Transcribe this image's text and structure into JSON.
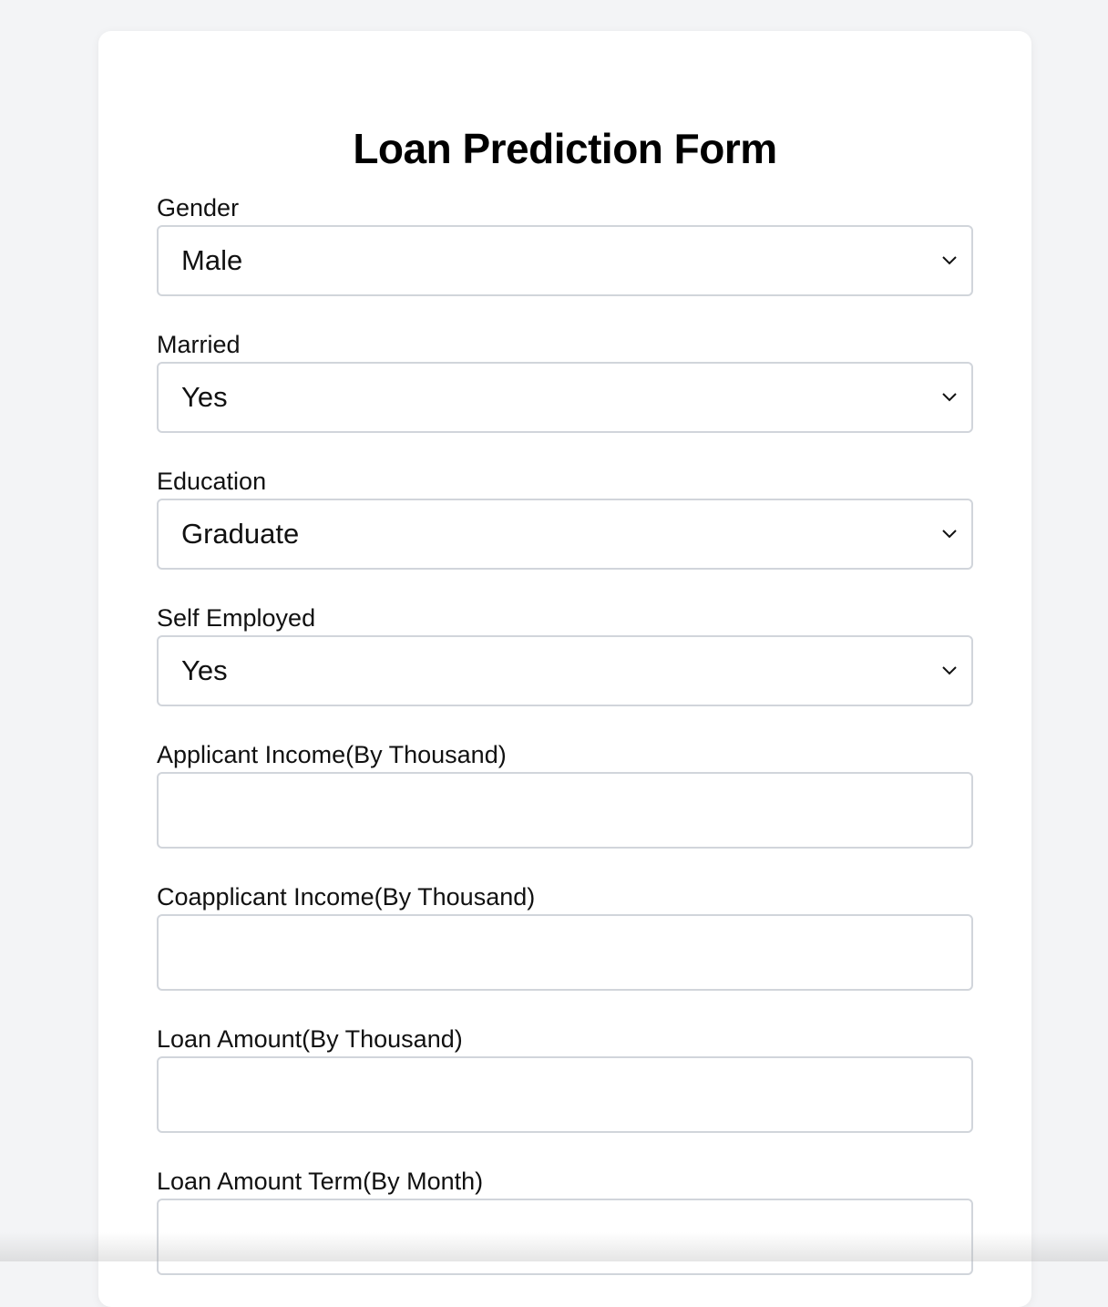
{
  "form": {
    "title": "Loan Prediction Form",
    "gender": {
      "label": "Gender",
      "value": "Male"
    },
    "married": {
      "label": "Married",
      "value": "Yes"
    },
    "education": {
      "label": "Education",
      "value": "Graduate"
    },
    "self_employed": {
      "label": "Self Employed",
      "value": "Yes"
    },
    "applicant_income": {
      "label": "Applicant Income(By Thousand)",
      "value": ""
    },
    "coapplicant_income": {
      "label": "Coapplicant Income(By Thousand)",
      "value": ""
    },
    "loan_amount": {
      "label": "Loan Amount(By Thousand)",
      "value": ""
    },
    "loan_amount_term": {
      "label": "Loan Amount Term(By Month)",
      "value": ""
    }
  },
  "icons": {
    "select_arrow": "chevron-down-icon"
  },
  "colors": {
    "page_background": "#f3f4f6",
    "card_background": "#ffffff",
    "input_border": "#d1d5db",
    "text": "#111111"
  }
}
